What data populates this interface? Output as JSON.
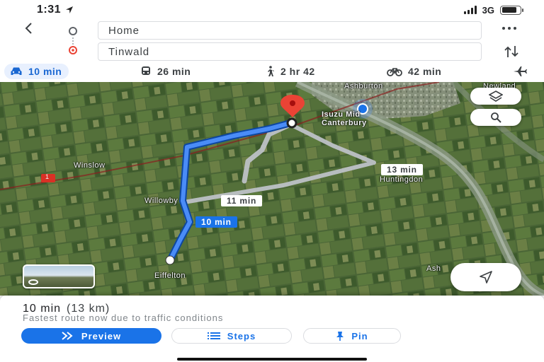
{
  "status_bar": {
    "time": "1:31",
    "network": "3G",
    "location_icon": "location-arrow-icon",
    "battery_level": 0.8
  },
  "search": {
    "origin": "Home",
    "destination": "Tinwald"
  },
  "modes": [
    {
      "id": "drive",
      "icon": "car-icon",
      "label": "10 min",
      "active": true
    },
    {
      "id": "transit",
      "icon": "transit-icon",
      "label": "26 min",
      "active": false
    },
    {
      "id": "walk",
      "icon": "walking-icon",
      "label": "2 hr 42",
      "active": false
    },
    {
      "id": "cycle",
      "icon": "bicycle-icon",
      "label": "42 min",
      "active": false
    },
    {
      "id": "flight",
      "icon": "plane-icon",
      "label": "",
      "active": false
    }
  ],
  "map": {
    "places": {
      "ashburton": "Ashburton",
      "newland": "Newland",
      "isuzu": "Isuzu Mid",
      "canterbury": "Canterbury",
      "winslow": "Winslow",
      "huntingdon": "Huntingdon",
      "willowby": "Willowby",
      "eiffelton": "Eiffelton",
      "ash": "Ash",
      "highway_shield": "1"
    },
    "route_chips": {
      "alt_13": "13 min",
      "alt_11": "11 min",
      "main": "10 min"
    },
    "colors": {
      "route_primary": "#1a73e8",
      "route_alternate": "#bdc1c6",
      "destination_pin": "#ea4335"
    }
  },
  "summary": {
    "duration": "10 min",
    "distance": "(13 km)",
    "note": "Fastest route now due to traffic conditions"
  },
  "actions": {
    "preview": "Preview",
    "steps": "Steps",
    "pin": "Pin"
  }
}
